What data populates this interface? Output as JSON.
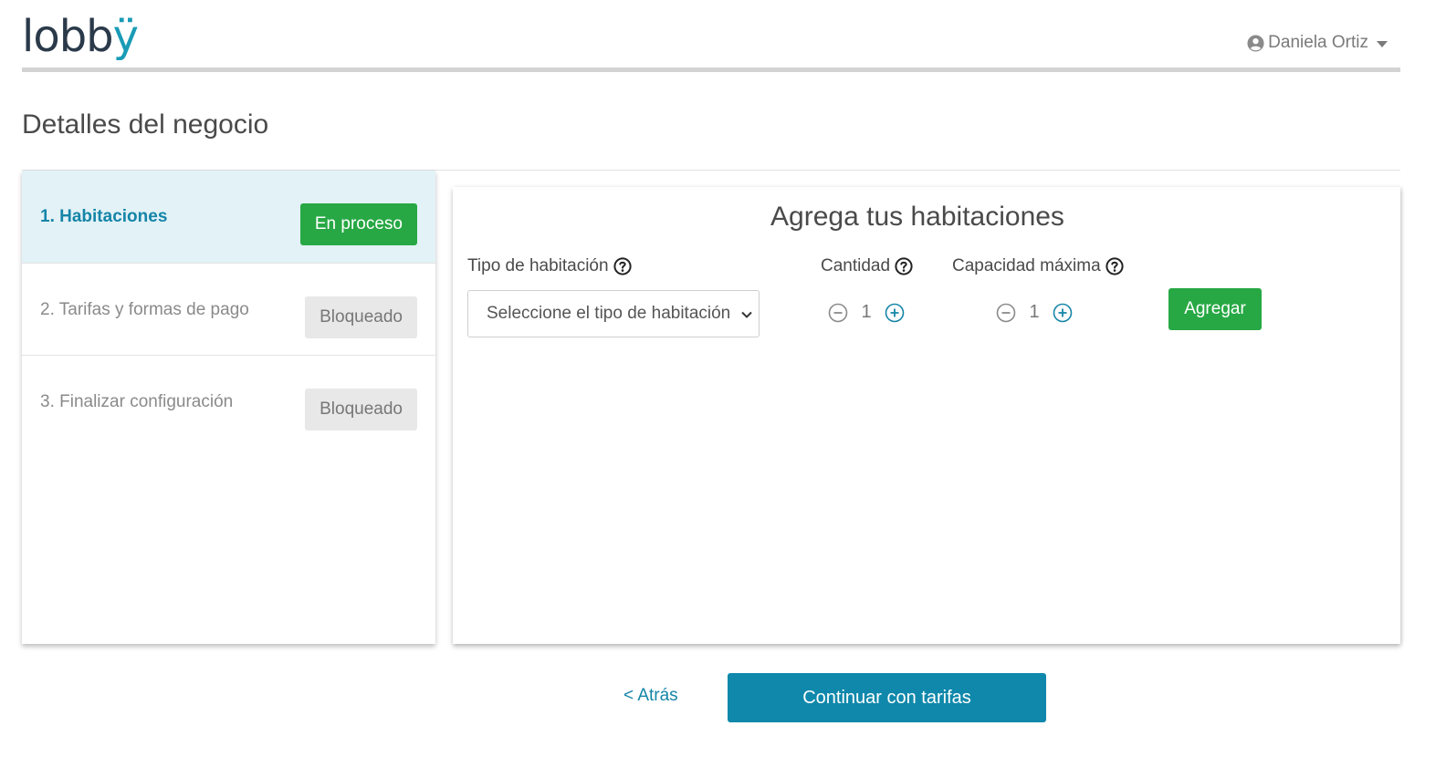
{
  "header": {
    "logo_text_main": "lobb",
    "logo_text_accent": "ÿ",
    "user_name": "Daniela Ortiz"
  },
  "page": {
    "title": "Detalles del negocio"
  },
  "steps": [
    {
      "label": "1. Habitaciones",
      "status": "En proceso"
    },
    {
      "label": "2. Tarifas y formas de pago",
      "status": "Bloqueado"
    },
    {
      "label": "3. Finalizar configuración",
      "status": "Bloqueado"
    }
  ],
  "panel": {
    "title": "Agrega tus habitaciones",
    "room_type_label": "Tipo de habitación",
    "room_type_placeholder": "Seleccione el tipo de habitación",
    "quantity_label": "Cantidad",
    "quantity_value": "1",
    "capacity_label": "Capacidad máxima",
    "capacity_value": "1",
    "add_button": "Agregar"
  },
  "footer": {
    "back_label": "< Atrás",
    "continue_label": "Continuar con tarifas"
  },
  "colors": {
    "primary": "#0f88ab",
    "success": "#27a844",
    "active_step_bg": "#e3f2f7",
    "active_step_text": "#1585a8"
  },
  "icons": {
    "user": "user-circle-icon",
    "caret": "caret-down-icon",
    "help": "question-circle-icon",
    "minus": "minus-circle-icon",
    "plus": "plus-circle-icon",
    "chevron": "chevron-down-icon"
  }
}
